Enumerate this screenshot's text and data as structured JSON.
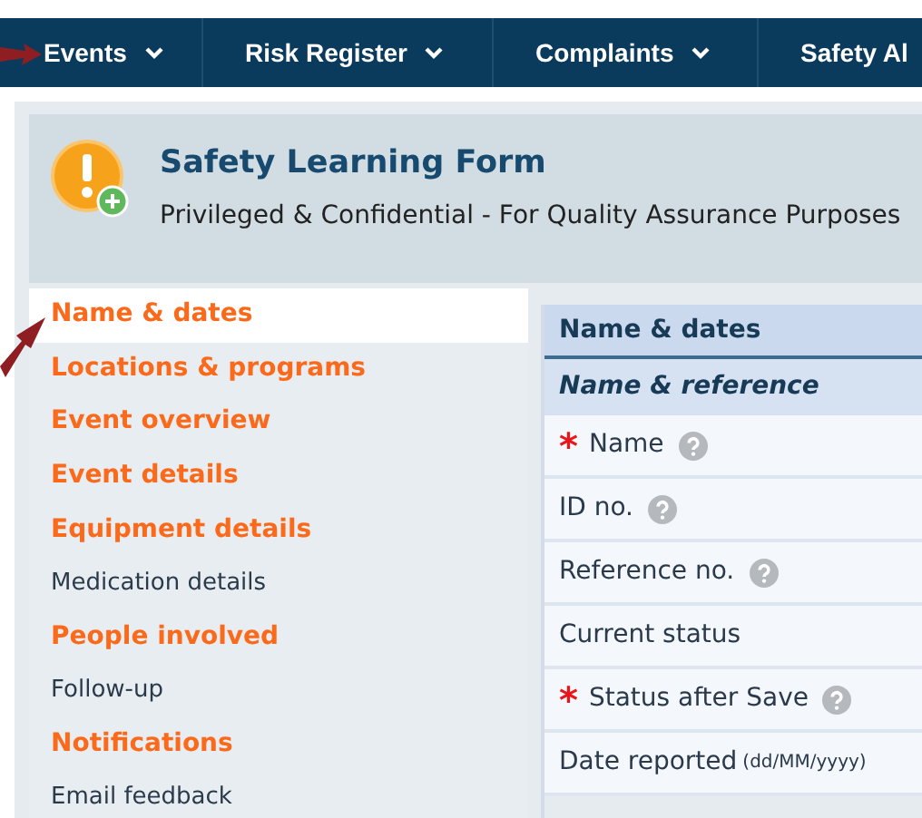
{
  "nav": [
    {
      "label": "Events"
    },
    {
      "label": "Risk Register"
    },
    {
      "label": "Complaints"
    },
    {
      "label": "Safety Al"
    }
  ],
  "header": {
    "title": "Safety Learning Form",
    "subtitle": "Privileged & Confidential - For Quality Assurance Purposes"
  },
  "sidebar": {
    "items": [
      {
        "label": "Name & dates",
        "selected": true,
        "highlighted": true
      },
      {
        "label": "Locations & programs",
        "selected": false,
        "highlighted": true
      },
      {
        "label": "Event overview",
        "selected": false,
        "highlighted": true
      },
      {
        "label": "Event details",
        "selected": false,
        "highlighted": true
      },
      {
        "label": "Equipment details",
        "selected": false,
        "highlighted": true
      },
      {
        "label": "Medication details",
        "selected": false,
        "highlighted": false
      },
      {
        "label": "People involved",
        "selected": false,
        "highlighted": true
      },
      {
        "label": "Follow-up",
        "selected": false,
        "highlighted": false
      },
      {
        "label": "Notifications",
        "selected": false,
        "highlighted": true
      },
      {
        "label": "Email feedback",
        "selected": false,
        "highlighted": false
      }
    ]
  },
  "form": {
    "required_mark": "*",
    "section": "Name & dates",
    "subsection": "Name & reference",
    "fields": [
      {
        "label": "Name",
        "required": true,
        "help": true
      },
      {
        "label": "ID no.",
        "required": false,
        "help": true
      },
      {
        "label": "Reference no.",
        "required": false,
        "help": true
      },
      {
        "label": "Current status",
        "required": false,
        "help": false
      },
      {
        "label": "Status after Save",
        "required": true,
        "help": true
      },
      {
        "label": "Date reported",
        "hint": "(dd/MM/yyyy)",
        "required": false,
        "help": false
      }
    ]
  }
}
